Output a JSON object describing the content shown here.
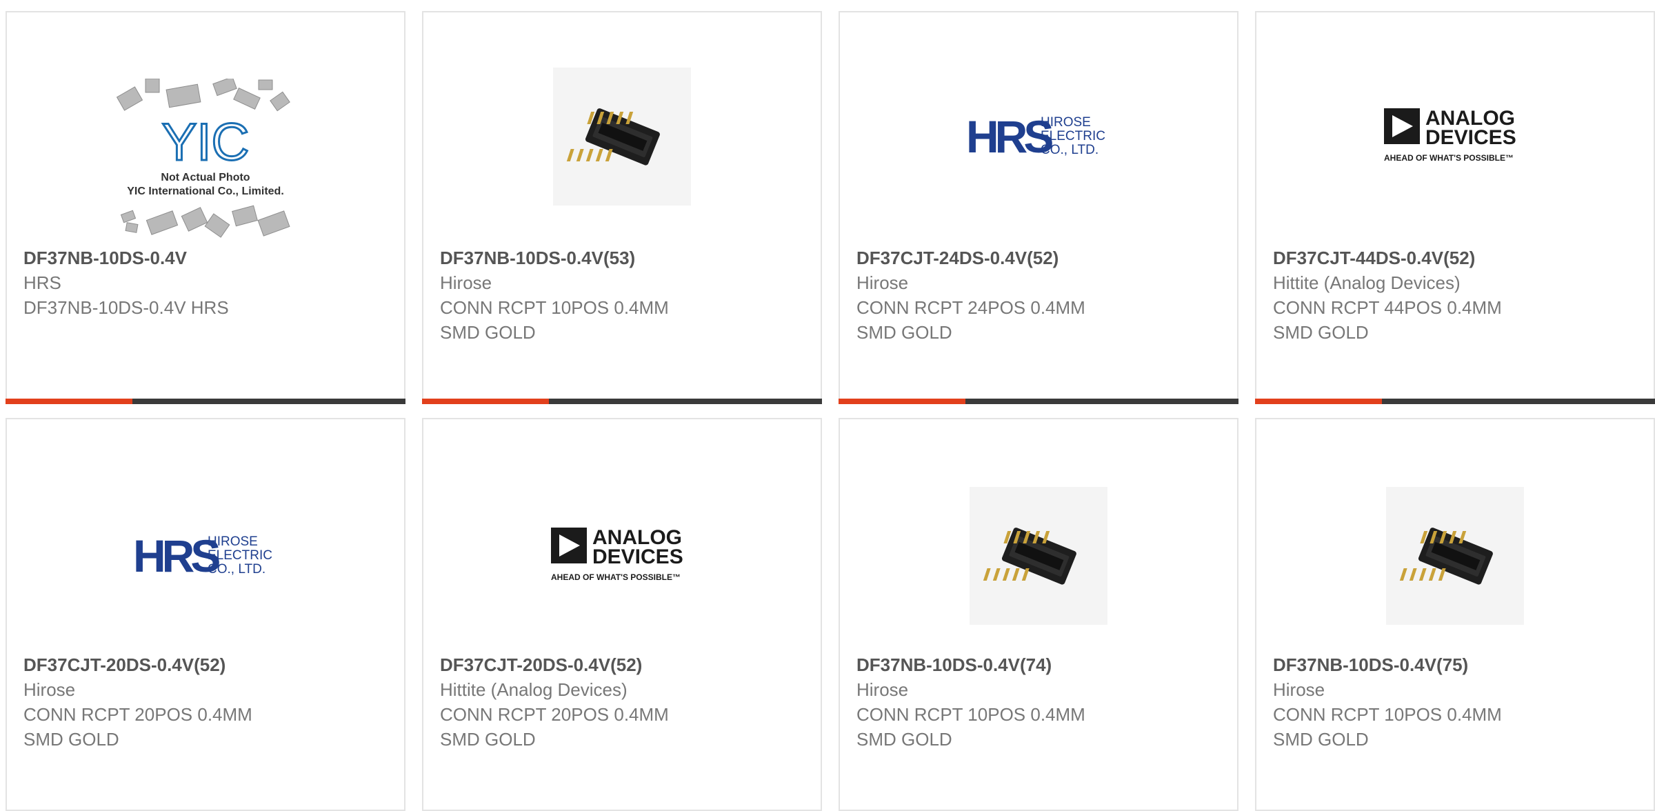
{
  "products": [
    {
      "part_number": "DF37NB-10DS-0.4V",
      "manufacturer": "HRS",
      "description": "DF37NB-10DS-0.4V HRS",
      "image": "yic-placeholder",
      "placeholder_text_1": "Not Actual Photo",
      "placeholder_text_2": "YIC International Co., Limited.",
      "placeholder_logo": "YIC"
    },
    {
      "part_number": "DF37NB-10DS-0.4V(53)",
      "manufacturer": "Hirose",
      "description": "CONN RCPT 10POS 0.4MM SMD GOLD",
      "image": "connector-photo"
    },
    {
      "part_number": "DF37CJT-24DS-0.4V(52)",
      "manufacturer": "Hirose",
      "description": "CONN RCPT 24POS 0.4MM SMD GOLD",
      "image": "hrs-logo",
      "logo_mark": "HRS",
      "logo_lines": [
        "HIROSE",
        "ELECTRIC",
        "CO., LTD."
      ]
    },
    {
      "part_number": "DF37CJT-44DS-0.4V(52)",
      "manufacturer": "Hittite (Analog Devices)",
      "description": "CONN RCPT 44POS 0.4MM SMD GOLD",
      "image": "analog-devices-logo",
      "logo_lines": [
        "ANALOG",
        "DEVICES"
      ],
      "logo_tagline": "AHEAD OF WHAT'S POSSIBLE™"
    },
    {
      "part_number": "DF37CJT-20DS-0.4V(52)",
      "manufacturer": "Hirose",
      "description": "CONN RCPT 20POS 0.4MM SMD GOLD",
      "image": "hrs-logo",
      "logo_mark": "HRS",
      "logo_lines": [
        "HIROSE",
        "ELECTRIC",
        "CO., LTD."
      ]
    },
    {
      "part_number": "DF37CJT-20DS-0.4V(52)",
      "manufacturer": "Hittite (Analog Devices)",
      "description": "CONN RCPT 20POS 0.4MM SMD GOLD",
      "image": "analog-devices-logo",
      "logo_lines": [
        "ANALOG",
        "DEVICES"
      ],
      "logo_tagline": "AHEAD OF WHAT'S POSSIBLE™"
    },
    {
      "part_number": "DF37NB-10DS-0.4V(74)",
      "manufacturer": "Hirose",
      "description": "CONN RCPT 10POS 0.4MM SMD GOLD",
      "image": "connector-photo"
    },
    {
      "part_number": "DF37NB-10DS-0.4V(75)",
      "manufacturer": "Hirose",
      "description": "CONN RCPT 10POS 0.4MM SMD GOLD",
      "image": "connector-photo"
    }
  ],
  "colors": {
    "accent": "#e2401c",
    "bar": "#3a3a3a",
    "border": "#e3e3e3",
    "hrs_blue": "#1f3f8f",
    "text_part": "#555555",
    "text_body": "#777777"
  }
}
